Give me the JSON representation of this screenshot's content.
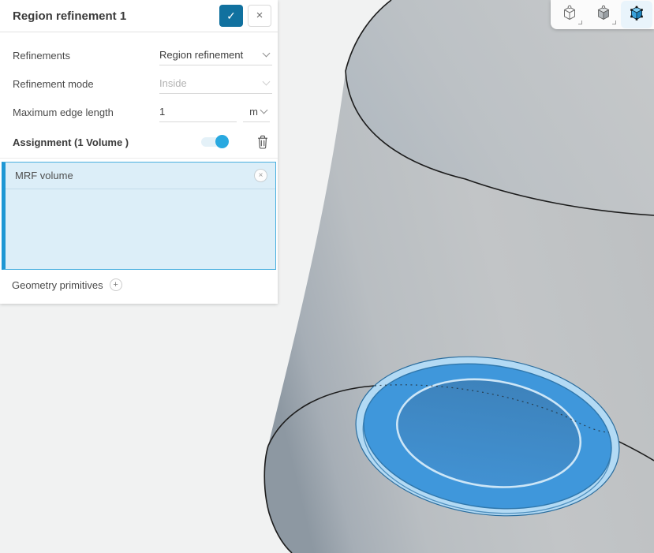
{
  "panel": {
    "title": "Region refinement 1",
    "header_icons": {
      "confirm": "✓",
      "close": "×"
    },
    "fields": [
      {
        "label": "Refinements",
        "value": "Region refinement"
      },
      {
        "label": "Refinement mode",
        "value": "Inside"
      },
      {
        "label": "Maximum edge length",
        "value": "1",
        "unit": "m"
      }
    ],
    "assignment": {
      "label": "Assignment (1 Volume )",
      "toggle_on": true,
      "items": [
        {
          "name": "MRF volume",
          "remove_icon": "×"
        }
      ],
      "geometry_primitives": {
        "label": "Geometry primitives",
        "add_icon": "+"
      }
    }
  },
  "toolbar": {
    "buttons": [
      {
        "name": "view-mode-wireframe-cube",
        "selected": false
      },
      {
        "name": "view-mode-solid-cube",
        "selected": false
      },
      {
        "name": "view-mode-selection-cube",
        "selected": true
      }
    ]
  },
  "scene": {
    "selected_volume": "MRF volume",
    "colors": {
      "accent_toggle": "#29a9e0",
      "confirm_button": "#11719f",
      "selection_band": "#3f97db",
      "selection_halo": "#b3daf4",
      "selection_inner": "#4189c6",
      "selection_ring": "#cde6f7",
      "cylinder_gray": "#bfc3c6",
      "edge_black": "#1c1c1c",
      "background": "#f1f2f2"
    }
  }
}
